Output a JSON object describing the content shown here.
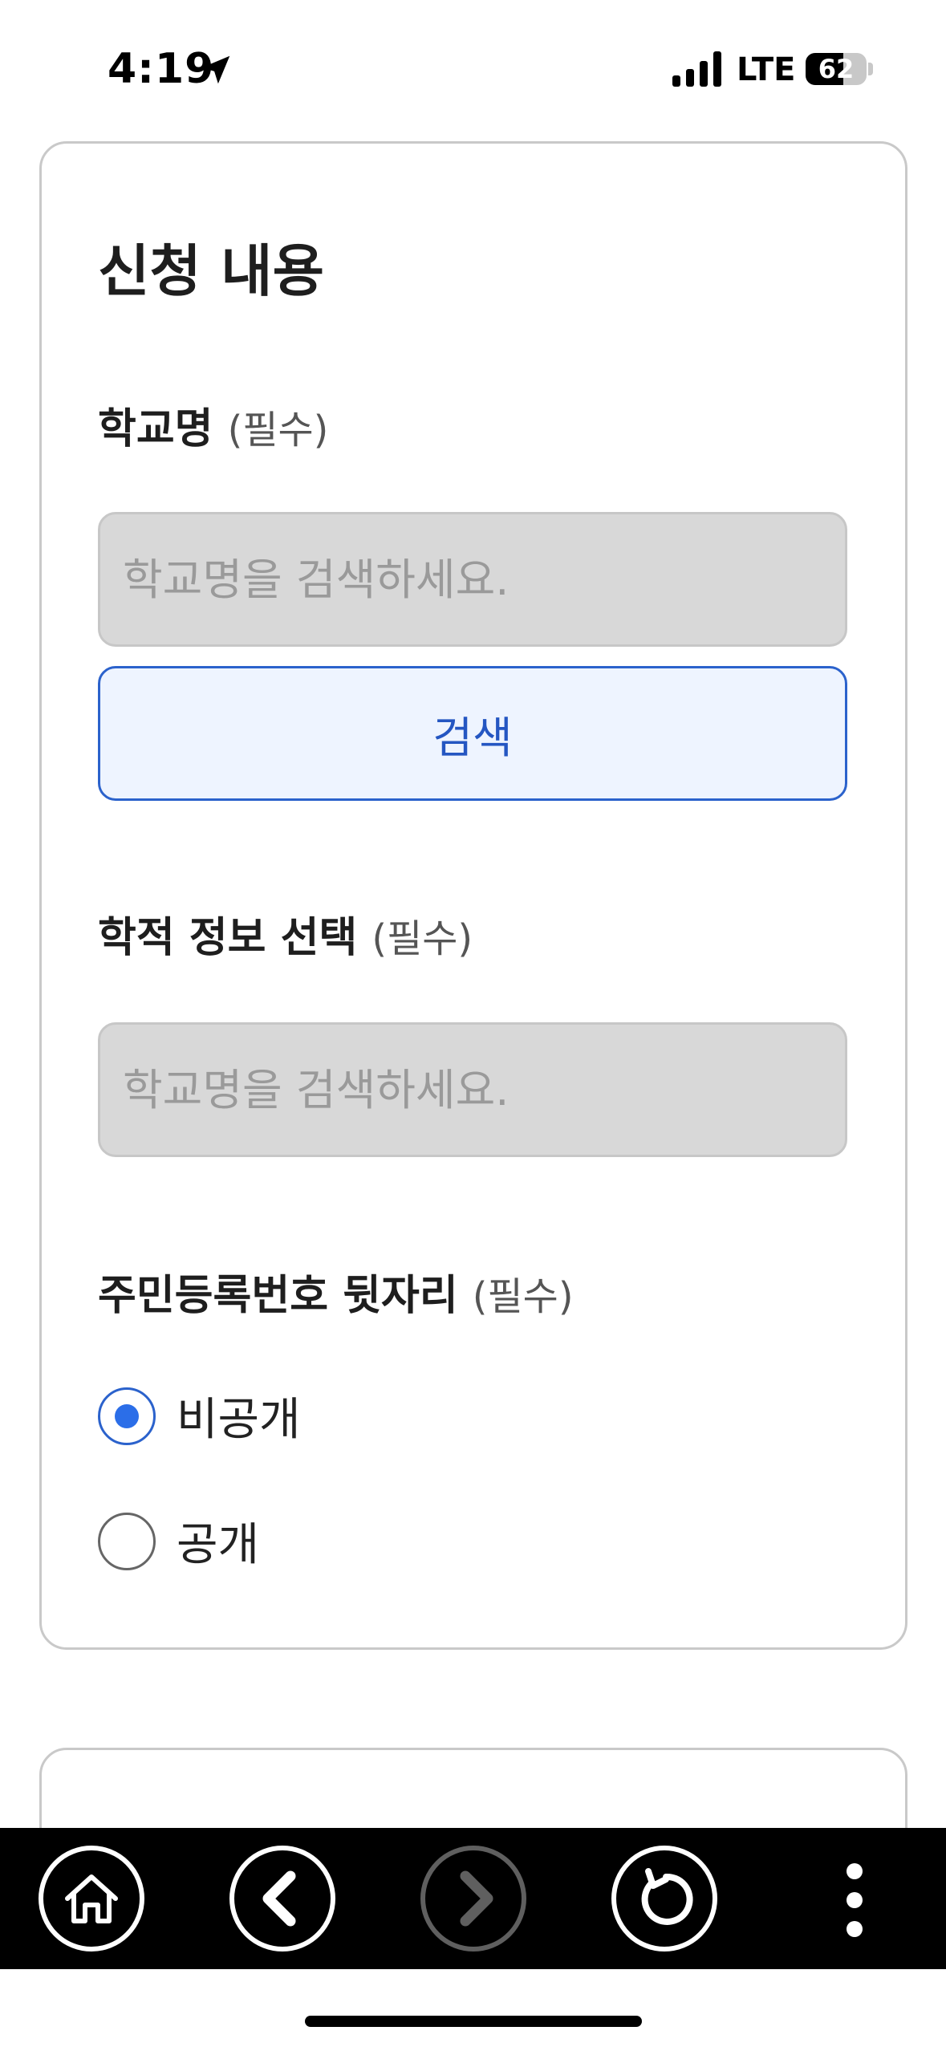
{
  "status_bar": {
    "time": "4:19",
    "network": "LTE",
    "battery_level": "62",
    "battery_fraction": 0.62
  },
  "form": {
    "title": "신청 내용",
    "school": {
      "label": "학교명",
      "required_tag": "(필수)",
      "placeholder": "학교명을 검색하세요.",
      "search_button": "검색"
    },
    "academic": {
      "label": "학적 정보 선택",
      "required_tag": "(필수)",
      "placeholder": "학교명을 검색하세요."
    },
    "resident_number": {
      "label": "주민등록번호 뒷자리",
      "required_tag": "(필수)",
      "options": [
        {
          "label": "비공개",
          "checked": true
        },
        {
          "label": "공개",
          "checked": false
        }
      ]
    }
  },
  "toolbar": {
    "buttons": [
      "home-icon",
      "back-icon",
      "forward-icon",
      "refresh-icon",
      "more-icon"
    ],
    "forward_enabled": false
  },
  "colors": {
    "accent": "#2b62cc",
    "radio_dot": "#2b6ee8",
    "input_bg": "#d8d8d8",
    "button_bg": "#eef4ff"
  }
}
